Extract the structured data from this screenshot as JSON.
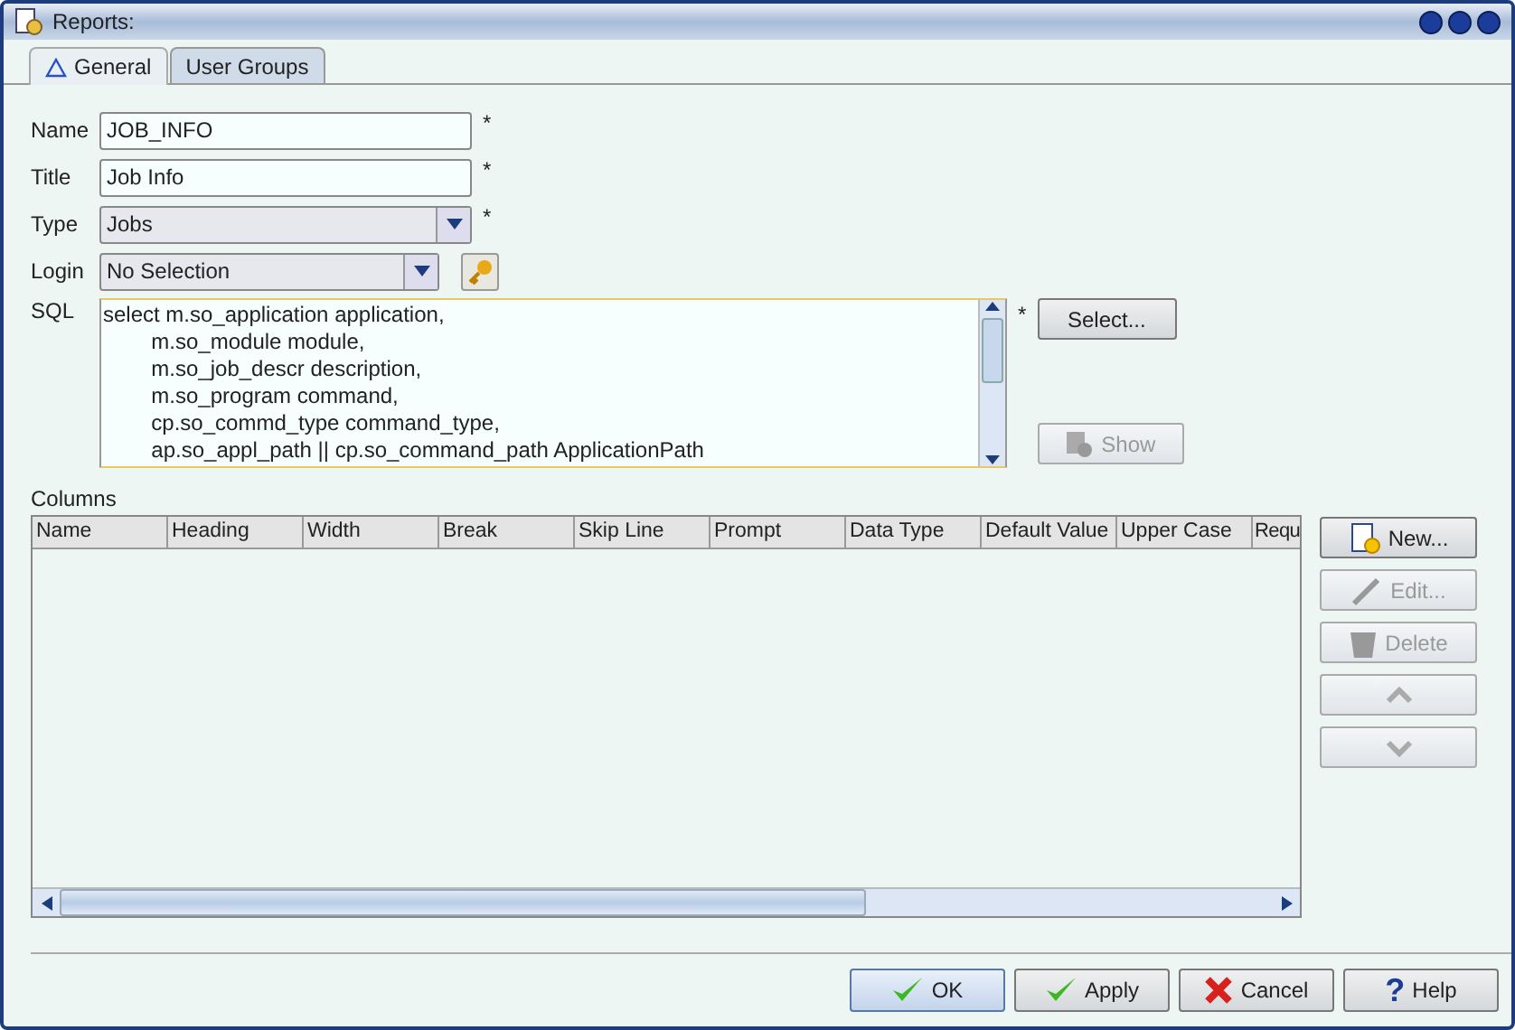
{
  "window": {
    "title": "Reports:"
  },
  "tabs": [
    {
      "label": "General",
      "selected": true,
      "warning": true
    },
    {
      "label": "User Groups",
      "selected": false,
      "warning": false
    }
  ],
  "fields": [
    {
      "label": "Name",
      "kind": "text",
      "value": "JOB_INFO",
      "marker": "*"
    },
    {
      "label": "Title",
      "kind": "text",
      "value": "Job Info",
      "marker": "*"
    },
    {
      "label": "Type",
      "kind": "combo",
      "value": "Jobs",
      "marker": "*"
    },
    {
      "label": "Login",
      "kind": "combo-key",
      "value": "No Selection"
    }
  ],
  "sql": {
    "label": "SQL",
    "marker": "*",
    "lines": [
      "select m.so_application application,",
      "        m.so_module module,",
      "        m.so_job_descr description,",
      "        m.so_program command,",
      "        cp.so_commd_type command_type,",
      "        ap.so_appl_path || cp.so_command_path ApplicationPath"
    ],
    "buttons": [
      {
        "label": "Select...",
        "disabled": false
      },
      {
        "label": "Show",
        "disabled": true
      }
    ]
  },
  "columns": {
    "label": "Columns",
    "headers": [
      "Name",
      "Heading",
      "Width",
      "Break",
      "Skip Line",
      "Prompt",
      "Data Type",
      "Default Value",
      "Upper Case",
      "Requ"
    ],
    "buttons": [
      {
        "kind": "new",
        "label": "New...",
        "disabled": false
      },
      {
        "kind": "edit",
        "label": "Edit...",
        "disabled": true
      },
      {
        "kind": "delete",
        "label": "Delete",
        "disabled": true
      },
      {
        "kind": "up",
        "disabled": true
      },
      {
        "kind": "down",
        "disabled": true
      }
    ]
  },
  "footer_buttons": [
    {
      "kind": "ok",
      "label": "OK",
      "default": true
    },
    {
      "kind": "apply",
      "label": "Apply",
      "default": false
    },
    {
      "kind": "cancel",
      "label": "Cancel",
      "default": false
    },
    {
      "kind": "help",
      "icon": "?",
      "label": "Help",
      "default": false
    }
  ]
}
